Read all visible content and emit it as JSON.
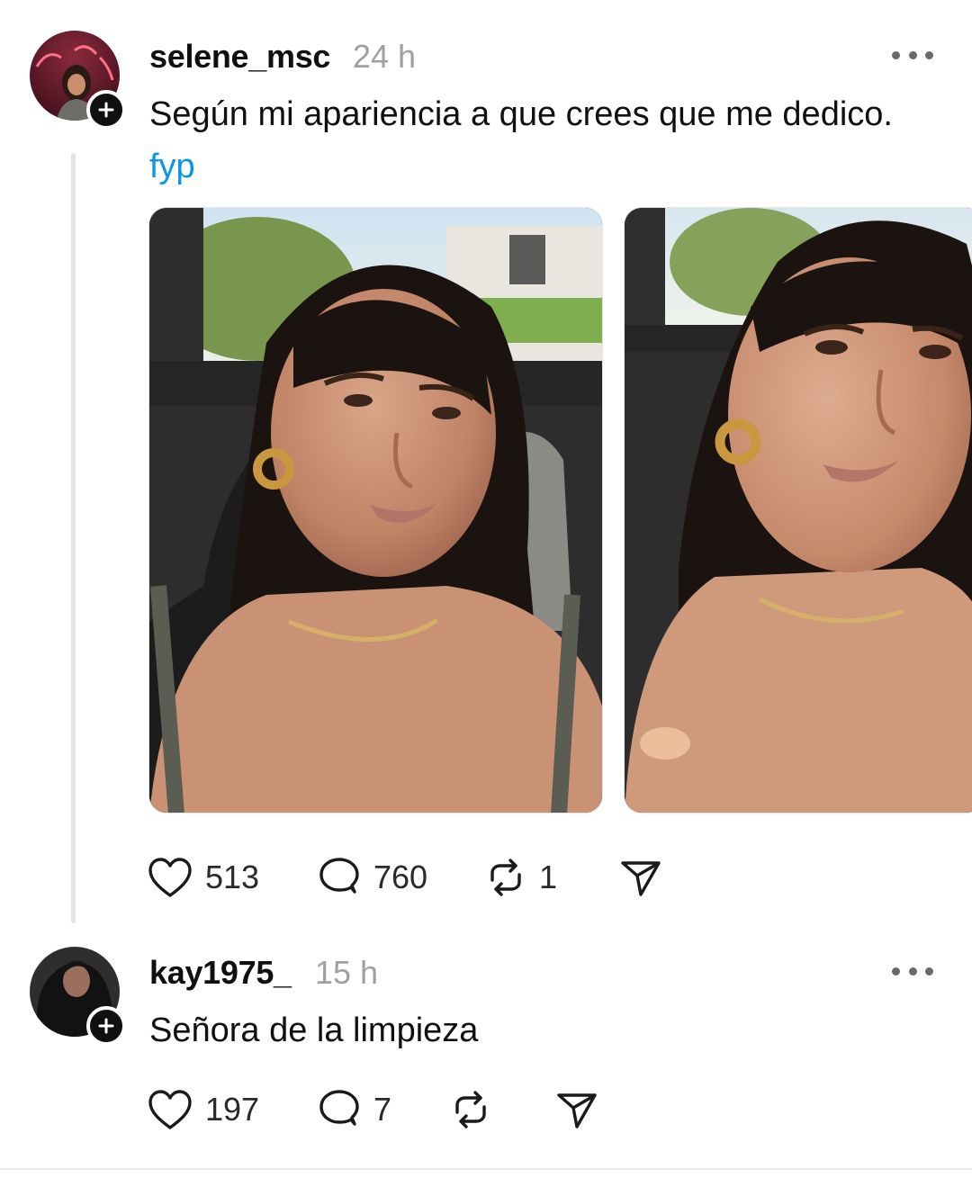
{
  "post": {
    "username": "selene_msc",
    "time": "24 h",
    "text": "Según mi apariencia a que crees que me dedico.",
    "tag": "fyp",
    "images": [
      "photo-1",
      "photo-2"
    ],
    "likes": "513",
    "comments": "760",
    "reposts": "1"
  },
  "reply": {
    "username": "kay1975_",
    "time": "15 h",
    "text": "Señora de la limpieza",
    "likes": "197",
    "comments": "7"
  },
  "icons": {
    "like": "heart-icon",
    "comment": "comment-bubble-icon",
    "repost": "repost-icon",
    "share": "send-icon",
    "more": "more-dots-icon",
    "follow": "plus-icon"
  },
  "colors": {
    "text": "#101010",
    "muted": "#a0a0a0",
    "link": "#0b95e8",
    "thread_line": "#e3e3e3"
  }
}
